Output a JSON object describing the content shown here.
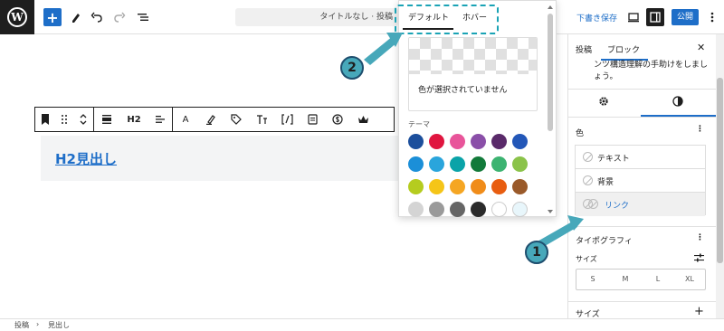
{
  "topbar": {
    "doc_title": "タイトルなし · 投稿",
    "draft_label": "下書き保存",
    "publish_label": "公開"
  },
  "block_toolbar": {
    "heading_level": "H2",
    "text_color_glyph": "A"
  },
  "editor": {
    "heading_text": "H2見出し"
  },
  "color_popover": {
    "tab_default": "デフォルト",
    "tab_hover": "ホバー",
    "no_color_text": "色が選択されていません",
    "theme_label": "テーマ",
    "palette": [
      "#1c4f9c",
      "#e0153f",
      "#e8559a",
      "#8a4fa8",
      "#5a2a6a",
      "#2357b8",
      "#1b8fd8",
      "#2aa5dc",
      "#0aa3a8",
      "#127a3a",
      "#3cb371",
      "#8bc34a",
      "#b5cc1f",
      "#f5c518",
      "#f5a623",
      "#f08c1a",
      "#e85d10",
      "#9a5a2a",
      "#d4d4d4",
      "#9a9a9a",
      "#666666",
      "#2b2b2b",
      "#ffffff",
      "#e8f6fb"
    ]
  },
  "sidebar": {
    "tab_post": "投稿",
    "tab_block": "ブロック",
    "description_tail": "ンツ構造理解の手助けをしましょう。",
    "color_section_label": "色",
    "color_items": [
      {
        "label": "テキスト"
      },
      {
        "label": "背景"
      },
      {
        "label": "リンク"
      }
    ],
    "typography_label": "タイポグラフィ",
    "size_label": "サイズ",
    "size_options": [
      "S",
      "M",
      "L",
      "XL"
    ],
    "size_section_label": "サイズ"
  },
  "callouts": {
    "one": "1",
    "two": "2"
  },
  "breadcrumb": {
    "root": "投稿",
    "separator": "›",
    "current": "見出し"
  },
  "colors": {
    "accent": "#1e6ec8",
    "callout": "#47a8ba",
    "highlight": "#1aa3b5"
  }
}
